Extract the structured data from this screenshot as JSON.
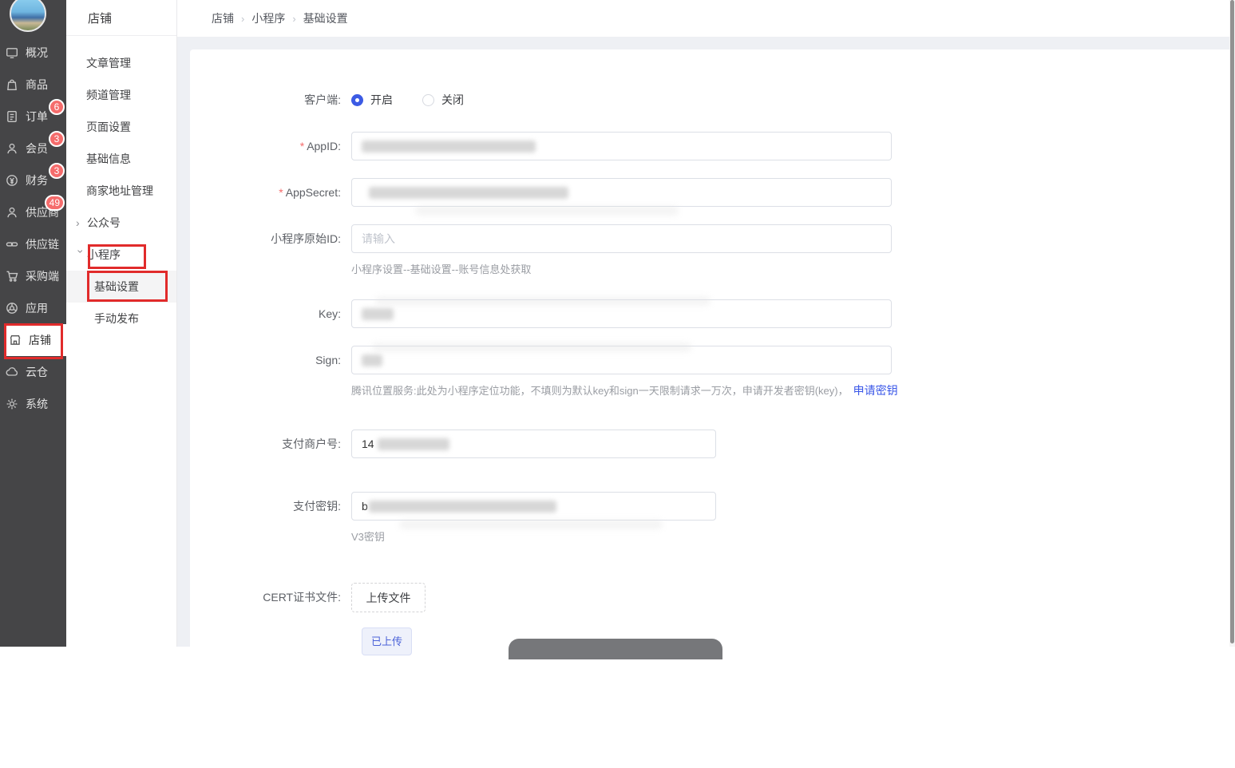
{
  "colors": {
    "accent_blue": "#3c5be4",
    "badge_red": "#f56c6c",
    "annotation_red": "#e12b2b",
    "link_blue": "#3a57e8"
  },
  "sidebar": {
    "items": [
      {
        "label": "概况",
        "icon": "dashboard-icon"
      },
      {
        "label": "商品",
        "icon": "goods-icon"
      },
      {
        "label": "订单",
        "icon": "orders-icon",
        "badge": "6"
      },
      {
        "label": "会员",
        "icon": "members-icon",
        "badge": "3"
      },
      {
        "label": "财务",
        "icon": "finance-icon",
        "badge": "3"
      },
      {
        "label": "供应商",
        "icon": "supplier-icon",
        "badge": "49"
      },
      {
        "label": "供应链",
        "icon": "supply-chain-icon"
      },
      {
        "label": "采购端",
        "icon": "procurement-icon"
      },
      {
        "label": "应用",
        "icon": "apps-icon"
      },
      {
        "label": "店铺",
        "icon": "shop-icon"
      },
      {
        "label": "云仓",
        "icon": "cloud-warehouse-icon"
      },
      {
        "label": "系统",
        "icon": "system-icon"
      }
    ]
  },
  "submenu": {
    "title": "店铺",
    "items": [
      {
        "label": "文章管理"
      },
      {
        "label": "频道管理"
      },
      {
        "label": "页面设置"
      },
      {
        "label": "基础信息"
      },
      {
        "label": "商家地址管理"
      }
    ],
    "groups": {
      "official_account": "公众号",
      "mini_program": "小程序",
      "children": [
        {
          "label": "基础设置"
        },
        {
          "label": "手动发布"
        }
      ]
    }
  },
  "breadcrumb": {
    "items": [
      "店铺",
      "小程序",
      "基础设置"
    ]
  },
  "form": {
    "client": {
      "label": "客户端:",
      "on": "开启",
      "off": "关闭"
    },
    "appid": {
      "label": "AppID:"
    },
    "appsecret": {
      "label": "AppSecret:"
    },
    "original_id": {
      "label": "小程序原始ID:",
      "placeholder": "请输入",
      "helper": "小程序设置--基础设置--账号信息处获取"
    },
    "key": {
      "label": "Key:"
    },
    "sign": {
      "label": "Sign:",
      "helper": "腾讯位置服务:此处为小程序定位功能，不填则为默认key和sign一天限制请求一万次，申请开发者密钥(key)，",
      "link": "申请密钥"
    },
    "pay_merchant": {
      "label": "支付商户号:",
      "value_prefix": "14"
    },
    "pay_secret": {
      "label": "支付密钥:",
      "value_prefix": "b",
      "helper": "V3密钥"
    },
    "cert": {
      "label": "CERT证书文件:",
      "button": "上传文件",
      "tag": "已上传"
    }
  }
}
